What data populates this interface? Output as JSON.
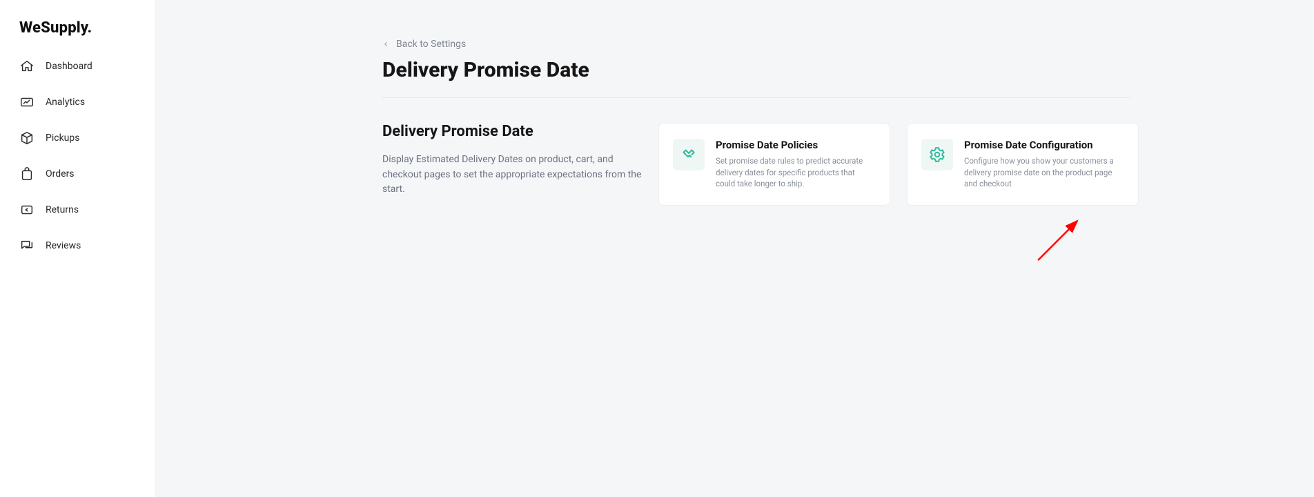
{
  "brand": "WeSupply.",
  "sidebar": {
    "items": [
      {
        "label": "Dashboard"
      },
      {
        "label": "Analytics"
      },
      {
        "label": "Pickups"
      },
      {
        "label": "Orders"
      },
      {
        "label": "Returns"
      },
      {
        "label": "Reviews"
      }
    ]
  },
  "back_link": "Back to Settings",
  "page_title": "Delivery Promise Date",
  "section": {
    "title": "Delivery Promise Date",
    "description": "Display Estimated Delivery Dates on product, cart, and checkout pages to set the appropriate expectations from the start."
  },
  "cards": [
    {
      "title": "Promise Date Policies",
      "description": "Set promise date rules to predict accurate delivery dates for specific products that could take longer to ship."
    },
    {
      "title": "Promise Date Configuration",
      "description": "Configure how you show your customers a delivery promise date on the product page and checkout"
    }
  ]
}
